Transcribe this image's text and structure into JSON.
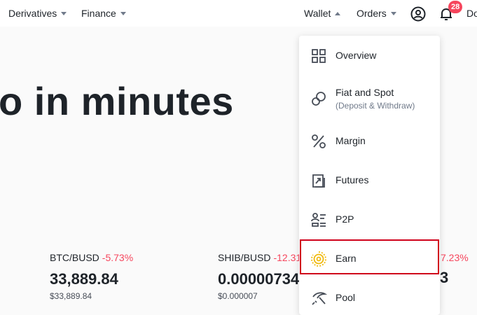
{
  "nav": {
    "derivatives": "Derivatives",
    "finance": "Finance",
    "wallet": "Wallet",
    "orders": "Orders",
    "notification_count": "28",
    "truncated_right": "Do"
  },
  "hero": {
    "headline": "o in minutes"
  },
  "tickers": [
    {
      "pair": "BTC/BUSD",
      "change": "-5.73%",
      "price": "33,889.84",
      "usd": "$33,889.84"
    },
    {
      "pair": "SHIB/BUSD",
      "change": "-12.31",
      "price": "0.00000734",
      "usd": "$0.000007"
    }
  ],
  "partial": {
    "change": "7.23%",
    "price": "3"
  },
  "wallet_menu": {
    "items": [
      {
        "label": "Overview",
        "icon": "grid-icon"
      },
      {
        "label": "Fiat and Spot",
        "sub": "(Deposit & Withdraw)",
        "icon": "coins-icon"
      },
      {
        "label": "Margin",
        "icon": "percent-icon"
      },
      {
        "label": "Futures",
        "icon": "futures-icon"
      },
      {
        "label": "P2P",
        "icon": "p2p-icon"
      },
      {
        "label": "Earn",
        "icon": "earn-icon"
      },
      {
        "label": "Pool",
        "icon": "pickaxe-icon"
      }
    ],
    "highlighted": "Earn"
  },
  "colors": {
    "accent": "#f0b90b",
    "negative": "#f6465d",
    "highlight_border": "#d0021b"
  }
}
